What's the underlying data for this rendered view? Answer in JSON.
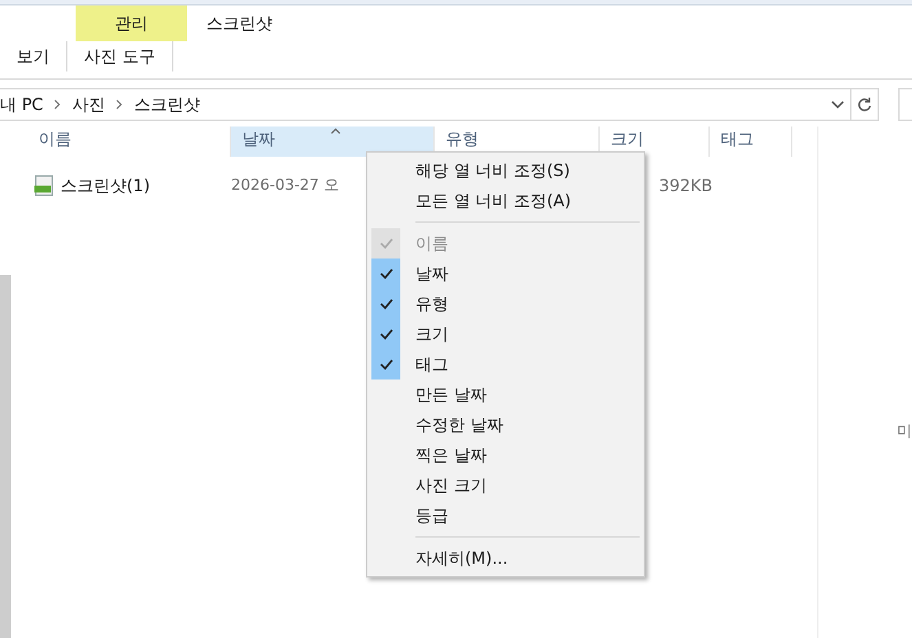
{
  "ribbon": {
    "tool_tab": {
      "label": "관리",
      "selected": true
    },
    "context_title": "스크린샷",
    "tabs": [
      {
        "label": "보기",
        "selected": false
      },
      {
        "label": "사진 도구",
        "selected": false
      }
    ]
  },
  "address": {
    "path": [
      "내 PC",
      "사진",
      "스크린샷"
    ]
  },
  "columns": [
    {
      "label": "이름",
      "selected": false
    },
    {
      "label": "날짜",
      "selected": true
    },
    {
      "label": "유형",
      "selected": false
    },
    {
      "label": "크기",
      "selected": false
    },
    {
      "label": "태그",
      "selected": false
    }
  ],
  "rows": [
    {
      "name": "스크린샷(1)",
      "date": "2026-03-27 오",
      "size": "392KB"
    }
  ],
  "preview_text": "미",
  "menu": {
    "actions": [
      "해당 열 너비 조정(S)",
      "모든 열 너비 조정(A)"
    ],
    "items": [
      {
        "label": "이름",
        "checked": true,
        "disabled": true
      },
      {
        "label": "날짜",
        "checked": true,
        "disabled": false
      },
      {
        "label": "유형",
        "checked": true,
        "disabled": false
      },
      {
        "label": "크기",
        "checked": true,
        "disabled": false
      },
      {
        "label": "태그",
        "checked": true,
        "disabled": false
      },
      {
        "label": "만든 날짜",
        "checked": false,
        "disabled": false
      },
      {
        "label": "수정한 날짜",
        "checked": false,
        "disabled": false
      },
      {
        "label": "찍은 날짜",
        "checked": false,
        "disabled": false
      },
      {
        "label": "사진 크기",
        "checked": false,
        "disabled": false
      },
      {
        "label": "등급",
        "checked": false,
        "disabled": false
      }
    ],
    "more": "자세히(M)..."
  }
}
